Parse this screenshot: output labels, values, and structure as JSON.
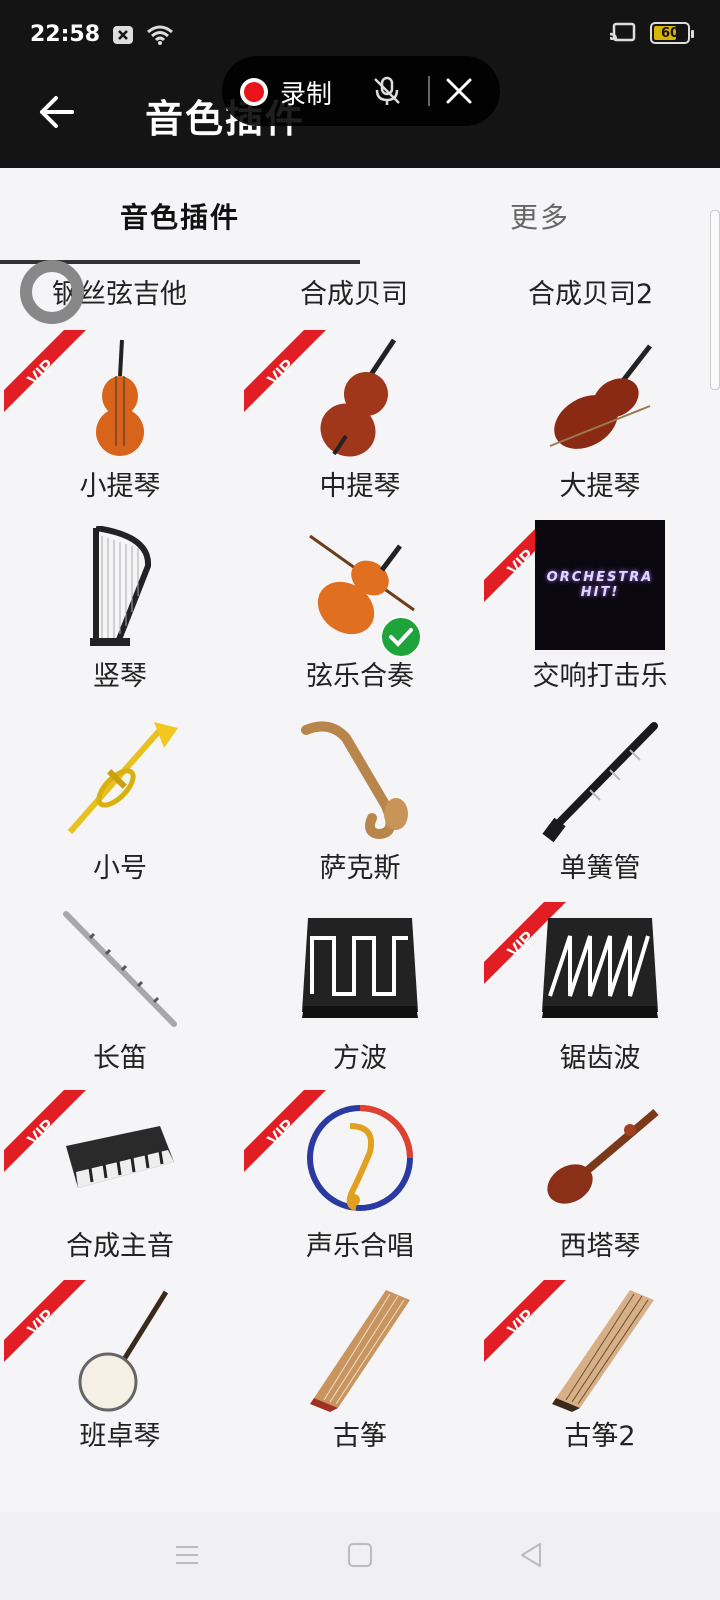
{
  "status": {
    "time": "22:58",
    "battery": "60"
  },
  "header": {
    "title": "音色插件"
  },
  "recording": {
    "label": "录制"
  },
  "tabs": [
    {
      "label": "音色插件"
    },
    {
      "label": "更多"
    }
  ],
  "prev_row": [
    "钢丝弦吉他",
    "合成贝司",
    "合成贝司2"
  ],
  "instruments": [
    {
      "name": "小提琴",
      "vip": true
    },
    {
      "name": "中提琴",
      "vip": true
    },
    {
      "name": "大提琴",
      "vip": false
    },
    {
      "name": "竖琴",
      "vip": false
    },
    {
      "name": "弦乐合奏",
      "vip": false,
      "selected": true
    },
    {
      "name": "交响打击乐",
      "vip": true
    },
    {
      "name": "小号",
      "vip": false
    },
    {
      "name": "萨克斯",
      "vip": false
    },
    {
      "name": "单簧管",
      "vip": false
    },
    {
      "name": "长笛",
      "vip": false
    },
    {
      "name": "方波",
      "vip": false
    },
    {
      "name": "锯齿波",
      "vip": true
    },
    {
      "name": "合成主音",
      "vip": true
    },
    {
      "name": "声乐合唱",
      "vip": true
    },
    {
      "name": "西塔琴",
      "vip": false
    },
    {
      "name": "班卓琴",
      "vip": true
    },
    {
      "name": "古筝",
      "vip": false
    },
    {
      "name": "古筝2",
      "vip": true
    }
  ],
  "orchestra_tile": {
    "line1": "ORCHESTRA",
    "line2": "HIT!"
  },
  "vip_badge": "VIP",
  "colors": {
    "topbar": "#141414",
    "vip_red": "#e01e24",
    "check_green": "#1fa33b",
    "record_red": "#e8141a"
  }
}
